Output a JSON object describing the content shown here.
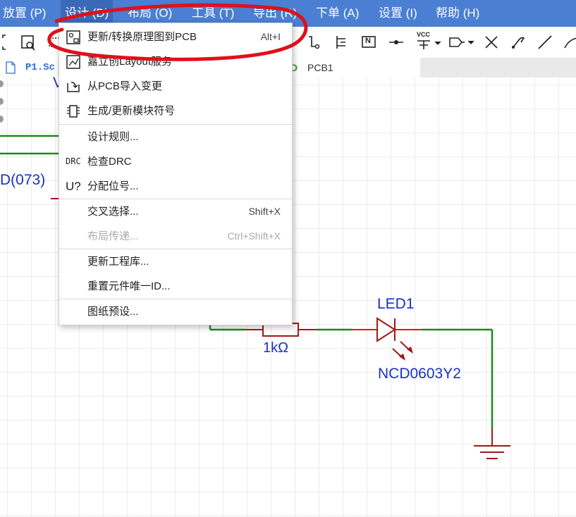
{
  "menubar": {
    "items": [
      {
        "label": "放置 (P)"
      },
      {
        "label": "设计 (D)"
      },
      {
        "label": "布局 (O)"
      },
      {
        "label": "工具 (T)"
      },
      {
        "label": "导出 (R)"
      },
      {
        "label": "下单 (A)"
      },
      {
        "label": "设置 (I)"
      },
      {
        "label": "帮助 (H)"
      }
    ],
    "active_index": 1
  },
  "tabs": {
    "schematic": "P1.Sc",
    "pcb": "PCB1"
  },
  "toolbar": {
    "vcc_label": "VCC",
    "net_label": "N"
  },
  "design_menu": {
    "items": [
      {
        "label": "更新/转换原理图到PCB",
        "shortcut": "Alt+I",
        "icon": "update-pcb-icon"
      },
      {
        "label": "嘉立创Layout服务",
        "icon": "layout-service-icon"
      },
      {
        "label": "从PCB导入变更",
        "icon": "import-changes-icon"
      },
      {
        "label": "生成/更新模块符号",
        "icon": "module-symbol-icon"
      },
      {
        "label": "设计规则..."
      },
      {
        "label": "检查DRC",
        "icon_text": "DRC"
      },
      {
        "label": "分配位号...",
        "icon_text": "U?"
      },
      {
        "label": "交叉选择...",
        "shortcut": "Shift+X"
      },
      {
        "label": "布局传递...",
        "shortcut": "Ctrl+Shift+X",
        "disabled": true
      },
      {
        "label": "更新工程库..."
      },
      {
        "label": "重置元件唯一ID..."
      },
      {
        "label": "图纸预设..."
      }
    ]
  },
  "schematic": {
    "partial_label_top": "V",
    "partial_label_left": "D(073)",
    "resistor_value": "1kΩ",
    "led_designator": "LED1",
    "led_part": "NCD0603Y2"
  },
  "colors": {
    "menubar": "#4a7fd3",
    "wire": "#1a8a1a",
    "component": "#a01818",
    "text": "#1a30c8",
    "annotation": "#e0101a"
  }
}
